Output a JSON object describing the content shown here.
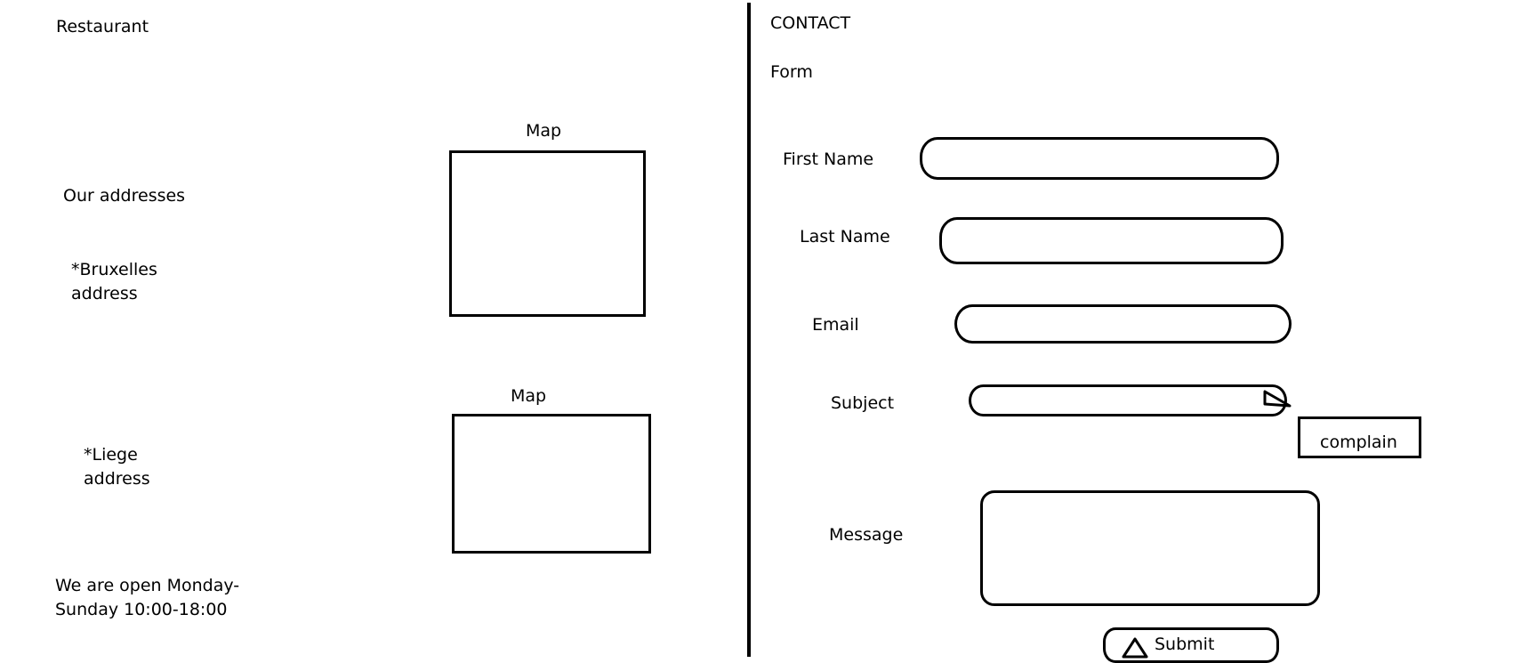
{
  "left": {
    "brand": "Restaurant",
    "addresses_heading": "Our addresses",
    "bruxelles_address": [
      "*Bruxelles",
      "address"
    ],
    "liege_address": [
      "*Liege",
      "address"
    ],
    "map_label_1": "Map",
    "map_label_2": "Map",
    "hours": [
      "We are open Monday-",
      "Sunday 10:00-18:00"
    ]
  },
  "right": {
    "contact_heading": "CONTACT",
    "form_heading": "Form",
    "fields": {
      "first_name_label": "First Name",
      "last_name_label": "Last Name",
      "email_label": "Email",
      "subject_label": "Subject",
      "subject_option": "complain",
      "message_label": "Message"
    },
    "submit_label": "Submit"
  },
  "icons": {
    "dropdown": "dropdown-arrow-icon",
    "submit": "triangle-icon"
  }
}
